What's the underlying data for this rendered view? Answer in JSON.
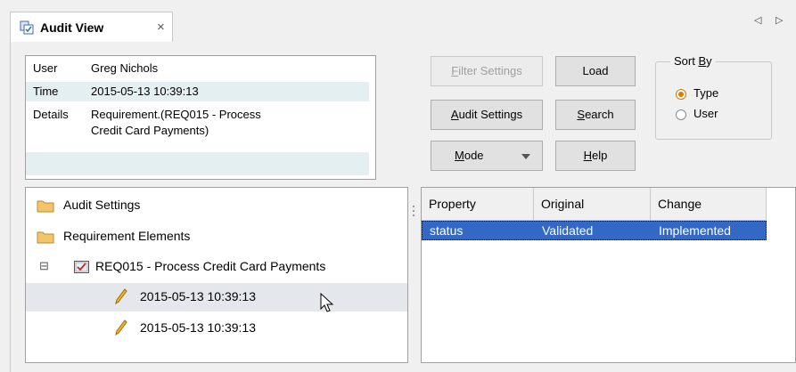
{
  "tab": {
    "title": "Audit View",
    "close": "×"
  },
  "nav": {
    "left": "◁",
    "right": "▷"
  },
  "details": {
    "rows": [
      {
        "label": "User",
        "value": "Greg Nichols"
      },
      {
        "label": "Time",
        "value": "2015-05-13 10:39:13"
      },
      {
        "label": "Details",
        "value_line1": "Requirement.(REQ015 - Process",
        "value_line2": "Credit Card Payments)"
      }
    ]
  },
  "buttons": {
    "filter_settings": {
      "pre": "",
      "u": "F",
      "post": "ilter Settings"
    },
    "load": "Load",
    "audit_settings": {
      "pre": "",
      "u": "A",
      "post": "udit Settings"
    },
    "search": {
      "pre": "",
      "u": "S",
      "post": "earch"
    },
    "mode": {
      "pre": "",
      "u": "M",
      "post": "ode"
    },
    "help": {
      "pre": "",
      "u": "H",
      "post": "elp"
    }
  },
  "sort": {
    "legend_pre": "Sort ",
    "legend_u": "B",
    "legend_post": "y",
    "options": [
      {
        "label": "Type",
        "selected": true
      },
      {
        "label": "User",
        "selected": false
      }
    ]
  },
  "tree": {
    "items": [
      {
        "label": "Audit Settings",
        "icon": "folder-icon"
      },
      {
        "label": "Requirement Elements",
        "icon": "folder-icon"
      },
      {
        "label": "REQ015 - Process Credit Card Payments",
        "icon": "requirement-icon",
        "expander": "⊟"
      },
      {
        "label": "2015-05-13 10:39:13",
        "icon": "pencil-icon"
      },
      {
        "label": "2015-05-13 10:39:13",
        "icon": "pencil-icon"
      }
    ]
  },
  "grid": {
    "columns": [
      "Property",
      "Original",
      "Change"
    ],
    "rows": [
      {
        "property": "status",
        "original": "Validated",
        "change": "Implemented"
      }
    ]
  },
  "colors": {
    "selection": "#3368c4",
    "row_shade": "#e4eff2",
    "radio_accent": "#e07b00"
  }
}
